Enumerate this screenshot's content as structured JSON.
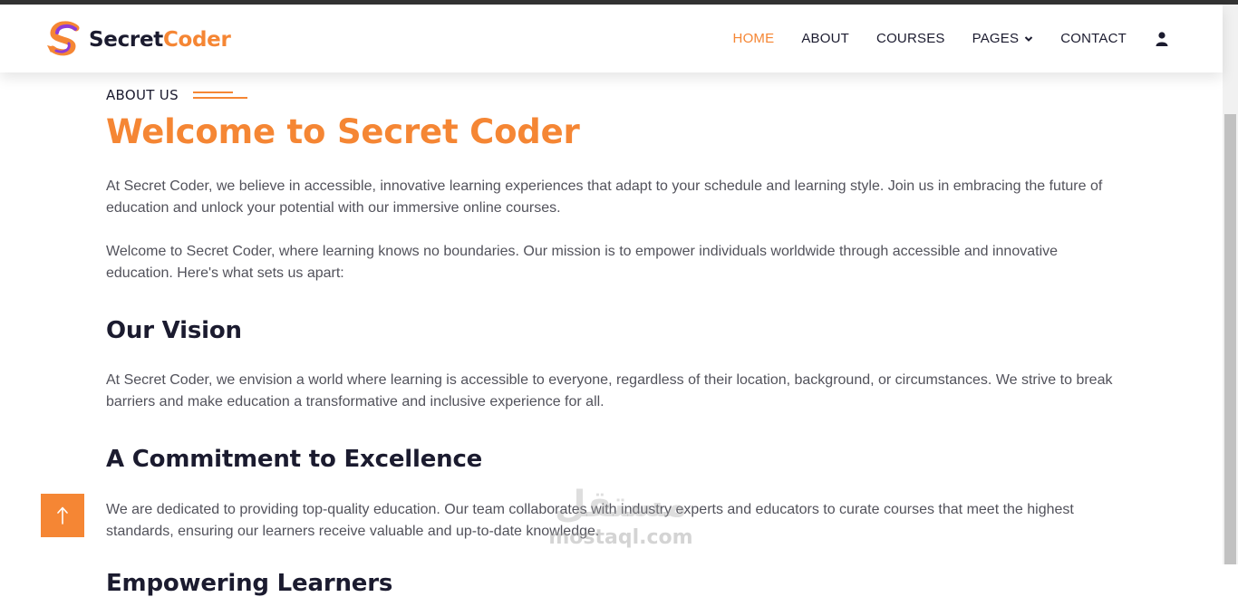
{
  "brand": {
    "name_part1": "Secret",
    "name_part2": "Coder",
    "logo_icon": "s-logo-icon"
  },
  "colors": {
    "accent": "#f58634",
    "dark": "#1b1b2f",
    "text": "#52525b"
  },
  "nav": {
    "items": [
      {
        "label": "HOME",
        "active": true
      },
      {
        "label": "ABOUT",
        "active": false
      },
      {
        "label": "COURSES",
        "active": false
      },
      {
        "label": "PAGES",
        "active": false,
        "dropdown": true
      },
      {
        "label": "CONTACT",
        "active": false
      }
    ],
    "user_icon": "user-icon"
  },
  "content": {
    "eyebrow": "ABOUT US",
    "title": "Welcome to Secret Coder",
    "intro_paragraph": "At Secret Coder, we believe in accessible, innovative learning experiences that adapt to your schedule and learning style. Join us in embracing the future of education and unlock your potential with our immersive online courses.",
    "welcome_paragraph": "Welcome to Secret Coder, where learning knows no boundaries. Our mission is to empower individuals worldwide through accessible and innovative education. Here's what sets us apart:",
    "sections": [
      {
        "heading": "Our Vision",
        "text": "At Secret Coder, we envision a world where learning is accessible to everyone, regardless of their location, background, or circumstances. We strive to break barriers and make education a transformative and inclusive experience for all."
      },
      {
        "heading": "A Commitment to Excellence",
        "text": "We are dedicated to providing top-quality education. Our team collaborates with industry experts and educators to curate courses that meet the highest standards, ensuring our learners receive valuable and up-to-date knowledge."
      },
      {
        "heading": "Empowering Learners"
      }
    ]
  },
  "scroll_top": {
    "icon": "arrow-up-icon"
  },
  "watermark": {
    "arabic": "مستقل",
    "latin": "mostaql.com"
  }
}
